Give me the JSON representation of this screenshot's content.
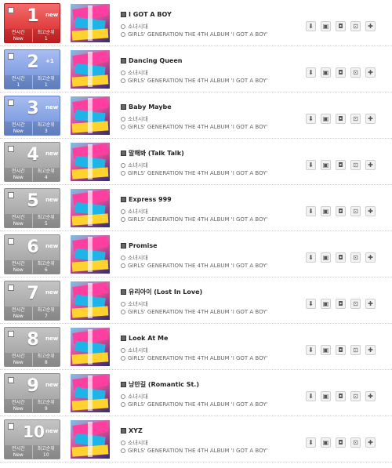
{
  "chart": {
    "stat_labels": {
      "current": "전시간",
      "peak": "최고순위"
    },
    "album": "GIRLS' GENERATION THE 4TH ALBUM 'I GOT A BOY'",
    "artist": "소녀시대",
    "actions": [
      "download-icon",
      "add-icon",
      "video-icon",
      "share-icon",
      "plus-icon"
    ],
    "action_glyphs": [
      "⬇",
      "▣",
      "◘",
      "⊡",
      "✚"
    ],
    "rows": [
      {
        "rank": "1",
        "badge": "new",
        "prev": "New",
        "peak": "1",
        "title": "I GOT A BOY",
        "style": "red"
      },
      {
        "rank": "2",
        "badge": "+1",
        "prev": "1",
        "peak": "1",
        "title": "Dancing Queen",
        "style": "blue"
      },
      {
        "rank": "3",
        "badge": "new",
        "prev": "New",
        "peak": "3",
        "title": "Baby Maybe",
        "style": "blue"
      },
      {
        "rank": "4",
        "badge": "new",
        "prev": "New",
        "peak": "4",
        "title": "말해봐 (Talk Talk)",
        "style": "gray"
      },
      {
        "rank": "5",
        "badge": "new",
        "prev": "New",
        "peak": "5",
        "title": "Express 999",
        "style": "gray"
      },
      {
        "rank": "6",
        "badge": "new",
        "prev": "New",
        "peak": "6",
        "title": "Promise",
        "style": "gray"
      },
      {
        "rank": "7",
        "badge": "new",
        "prev": "New",
        "peak": "7",
        "title": "유리아이 (Lost In Love)",
        "style": "gray"
      },
      {
        "rank": "8",
        "badge": "new",
        "prev": "New",
        "peak": "8",
        "title": "Look At Me",
        "style": "gray"
      },
      {
        "rank": "9",
        "badge": "new",
        "prev": "New",
        "peak": "9",
        "title": "낭만길 (Romantic St.)",
        "style": "gray"
      },
      {
        "rank": "10",
        "badge": "new",
        "prev": "New",
        "peak": "10",
        "title": "XYZ",
        "style": "gray"
      }
    ]
  }
}
